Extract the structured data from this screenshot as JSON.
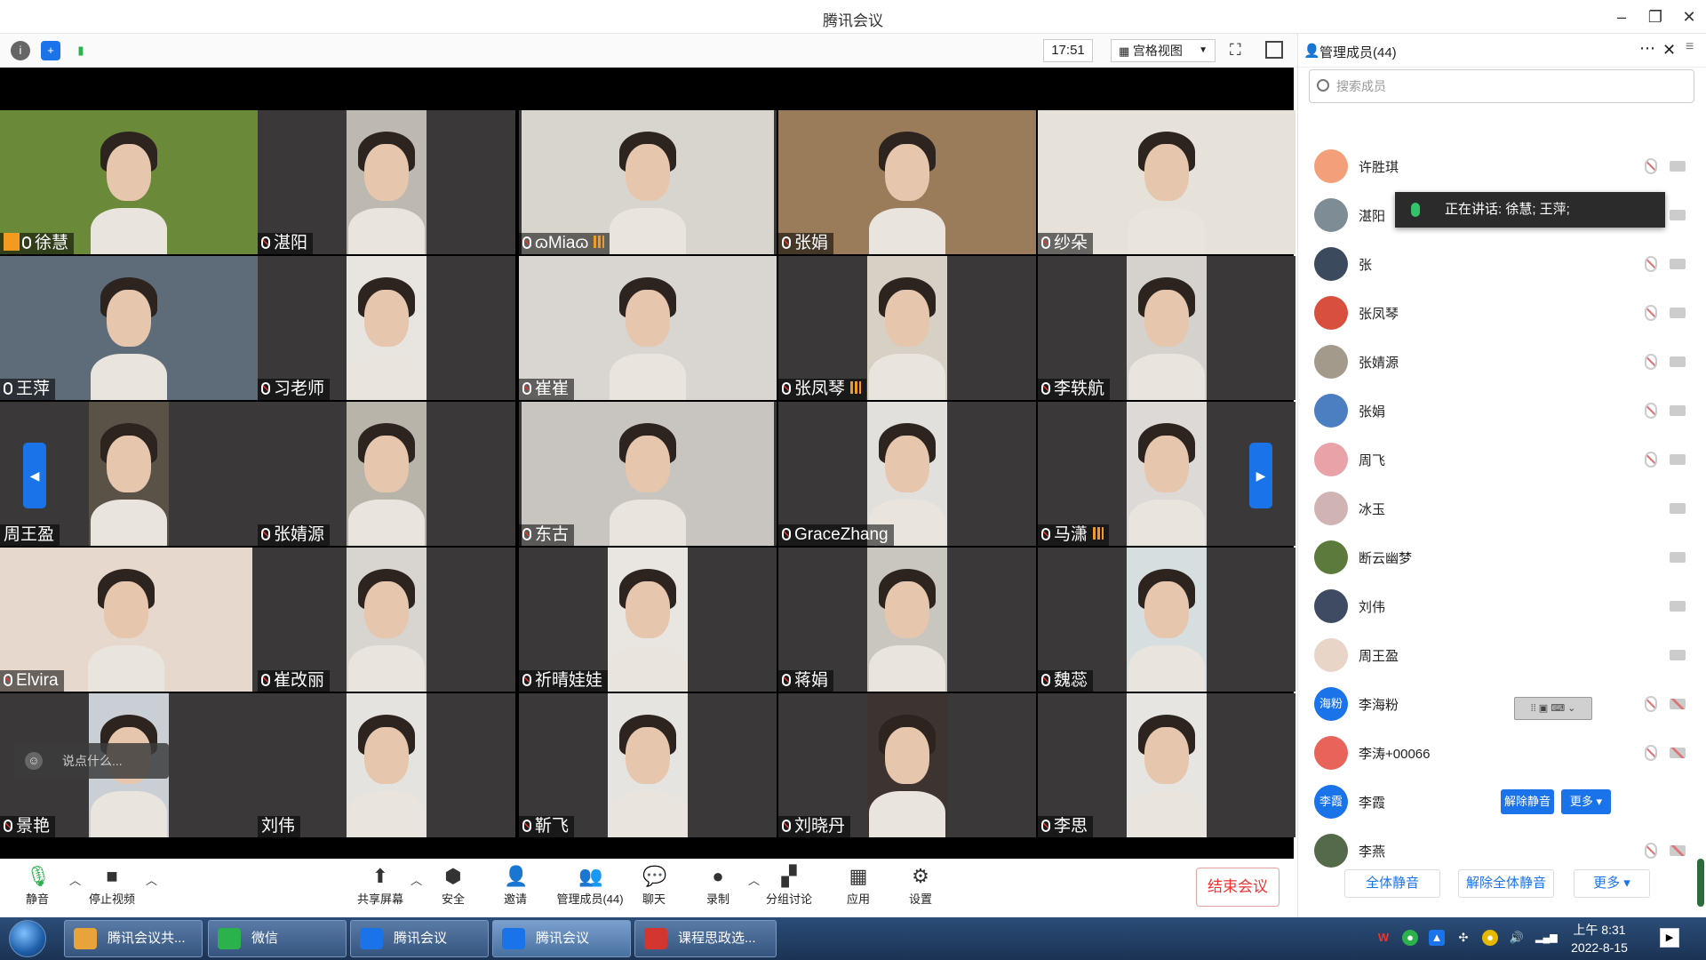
{
  "window": {
    "title": "腾讯会议"
  },
  "toolbar": {
    "time": "17:51",
    "view_label": "宫格视图"
  },
  "grid": {
    "tiles": [
      {
        "name": "徐慧",
        "mic": "on",
        "host": true,
        "level": false
      },
      {
        "name": "湛阳",
        "mic": "off",
        "level": false
      },
      {
        "name": "ɷMiaɷ",
        "mic": "off",
        "level": true
      },
      {
        "name": "张娟",
        "mic": "off",
        "level": false
      },
      {
        "name": "纱朵",
        "mic": "off",
        "level": false
      },
      {
        "name": "王萍",
        "mic": "on",
        "level": false
      },
      {
        "name": "习老师",
        "mic": "off",
        "level": false
      },
      {
        "name": "崔崔",
        "mic": "off",
        "level": false
      },
      {
        "name": "张凤琴",
        "mic": "off",
        "level": true
      },
      {
        "name": "李轶航",
        "mic": "off",
        "level": false
      },
      {
        "name": "周王盈",
        "mic": "none",
        "level": false
      },
      {
        "name": "张婧源",
        "mic": "off",
        "level": false
      },
      {
        "name": "东古",
        "mic": "off",
        "level": false
      },
      {
        "name": "GraceZhang",
        "mic": "off",
        "level": false
      },
      {
        "name": "马潇",
        "mic": "off",
        "level": true
      },
      {
        "name": "Elvira",
        "mic": "off",
        "level": false
      },
      {
        "name": "崔改丽",
        "mic": "off",
        "level": false
      },
      {
        "name": "祈晴娃娃",
        "mic": "off",
        "level": false
      },
      {
        "name": "蒋娟",
        "mic": "off",
        "level": false
      },
      {
        "name": "魏蕊",
        "mic": "off",
        "level": false
      },
      {
        "name": "景艳",
        "mic": "off",
        "level": false
      },
      {
        "name": "刘伟",
        "mic": "none",
        "level": false
      },
      {
        "name": "靳飞",
        "mic": "off",
        "level": false
      },
      {
        "name": "刘晓丹",
        "mic": "off",
        "level": false
      },
      {
        "name": "李思",
        "mic": "off",
        "level": false
      }
    ],
    "chat_placeholder": "说点什么..."
  },
  "bottombar": {
    "buttons": [
      {
        "label": "静音",
        "icon": "mic-icon"
      },
      {
        "label": "停止视频",
        "icon": "video-icon"
      },
      {
        "label": "共享屏幕",
        "icon": "share-screen-icon"
      },
      {
        "label": "安全",
        "icon": "shield-icon"
      },
      {
        "label": "邀请",
        "icon": "invite-icon"
      },
      {
        "label": "管理成员(44)",
        "icon": "members-icon"
      },
      {
        "label": "聊天",
        "icon": "chat-icon"
      },
      {
        "label": "录制",
        "icon": "record-icon"
      },
      {
        "label": "分组讨论",
        "icon": "breakout-icon"
      },
      {
        "label": "应用",
        "icon": "apps-icon"
      },
      {
        "label": "设置",
        "icon": "gear-icon"
      }
    ],
    "end_meeting": "结束会议"
  },
  "sidebar": {
    "title": "管理成员(44)",
    "search_placeholder": "搜索成员",
    "speaking_text": "正在讲话: 徐慧; 王萍;",
    "members": [
      {
        "name": "许胜琪",
        "avatar_color": "#f3a07a",
        "mic": "off",
        "cam": "on"
      },
      {
        "name": "湛阳",
        "avatar_color": "#7e8c95",
        "mic": "off",
        "cam": "on"
      },
      {
        "name": "张",
        "avatar_color": "#3b4a5c",
        "mic": "off",
        "cam": "on"
      },
      {
        "name": "张凤琴",
        "avatar_color": "#d94f3d",
        "mic": "off",
        "cam": "on"
      },
      {
        "name": "张婧源",
        "avatar_color": "#a49a8c",
        "mic": "off",
        "cam": "on"
      },
      {
        "name": "张娟",
        "avatar_color": "#4b7fc1",
        "mic": "off",
        "cam": "on"
      },
      {
        "name": "周飞",
        "avatar_color": "#e8a2a8",
        "mic": "off",
        "cam": "on"
      },
      {
        "name": "冰玉",
        "avatar_color": "#d0b4b4",
        "mic": "none",
        "cam": "on"
      },
      {
        "name": "断云幽梦",
        "avatar_color": "#5c7a3c",
        "mic": "none",
        "cam": "on"
      },
      {
        "name": "刘伟",
        "avatar_color": "#3e4b62",
        "mic": "none",
        "cam": "on"
      },
      {
        "name": "周王盈",
        "avatar_color": "#e9d4c8",
        "mic": "none",
        "cam": "on"
      },
      {
        "name": "李海粉",
        "avatar_text": "海粉",
        "avatar_color": "#1a73e8",
        "mic": "off",
        "cam": "off"
      },
      {
        "name": "李涛+00066",
        "avatar_color": "#e8635a",
        "mic": "off",
        "cam": "off"
      },
      {
        "name": "李霞",
        "avatar_text": "李霞",
        "avatar_color": "#1a73e8",
        "mic": "none",
        "cam": "none",
        "unmute_label": "解除静音",
        "more_label": "更多 ▾"
      },
      {
        "name": "李燕",
        "avatar_color": "#556a4a",
        "mic": "off",
        "cam": "off"
      }
    ],
    "footer": {
      "mute_all": "全体静音",
      "unmute_all": "解除全体静音",
      "more": "更多 ▾"
    }
  },
  "taskbar": {
    "items": [
      {
        "label": "腾讯会议共...",
        "color": "#e8a33a"
      },
      {
        "label": "微信",
        "color": "#2bb24c"
      },
      {
        "label": "腾讯会议",
        "color": "#1a73e8"
      },
      {
        "label": "腾讯会议",
        "color": "#1a73e8"
      },
      {
        "label": "课程思政选...",
        "color": "#d2362f"
      }
    ],
    "time": "上午 8:31",
    "date": "2022-8-15"
  }
}
